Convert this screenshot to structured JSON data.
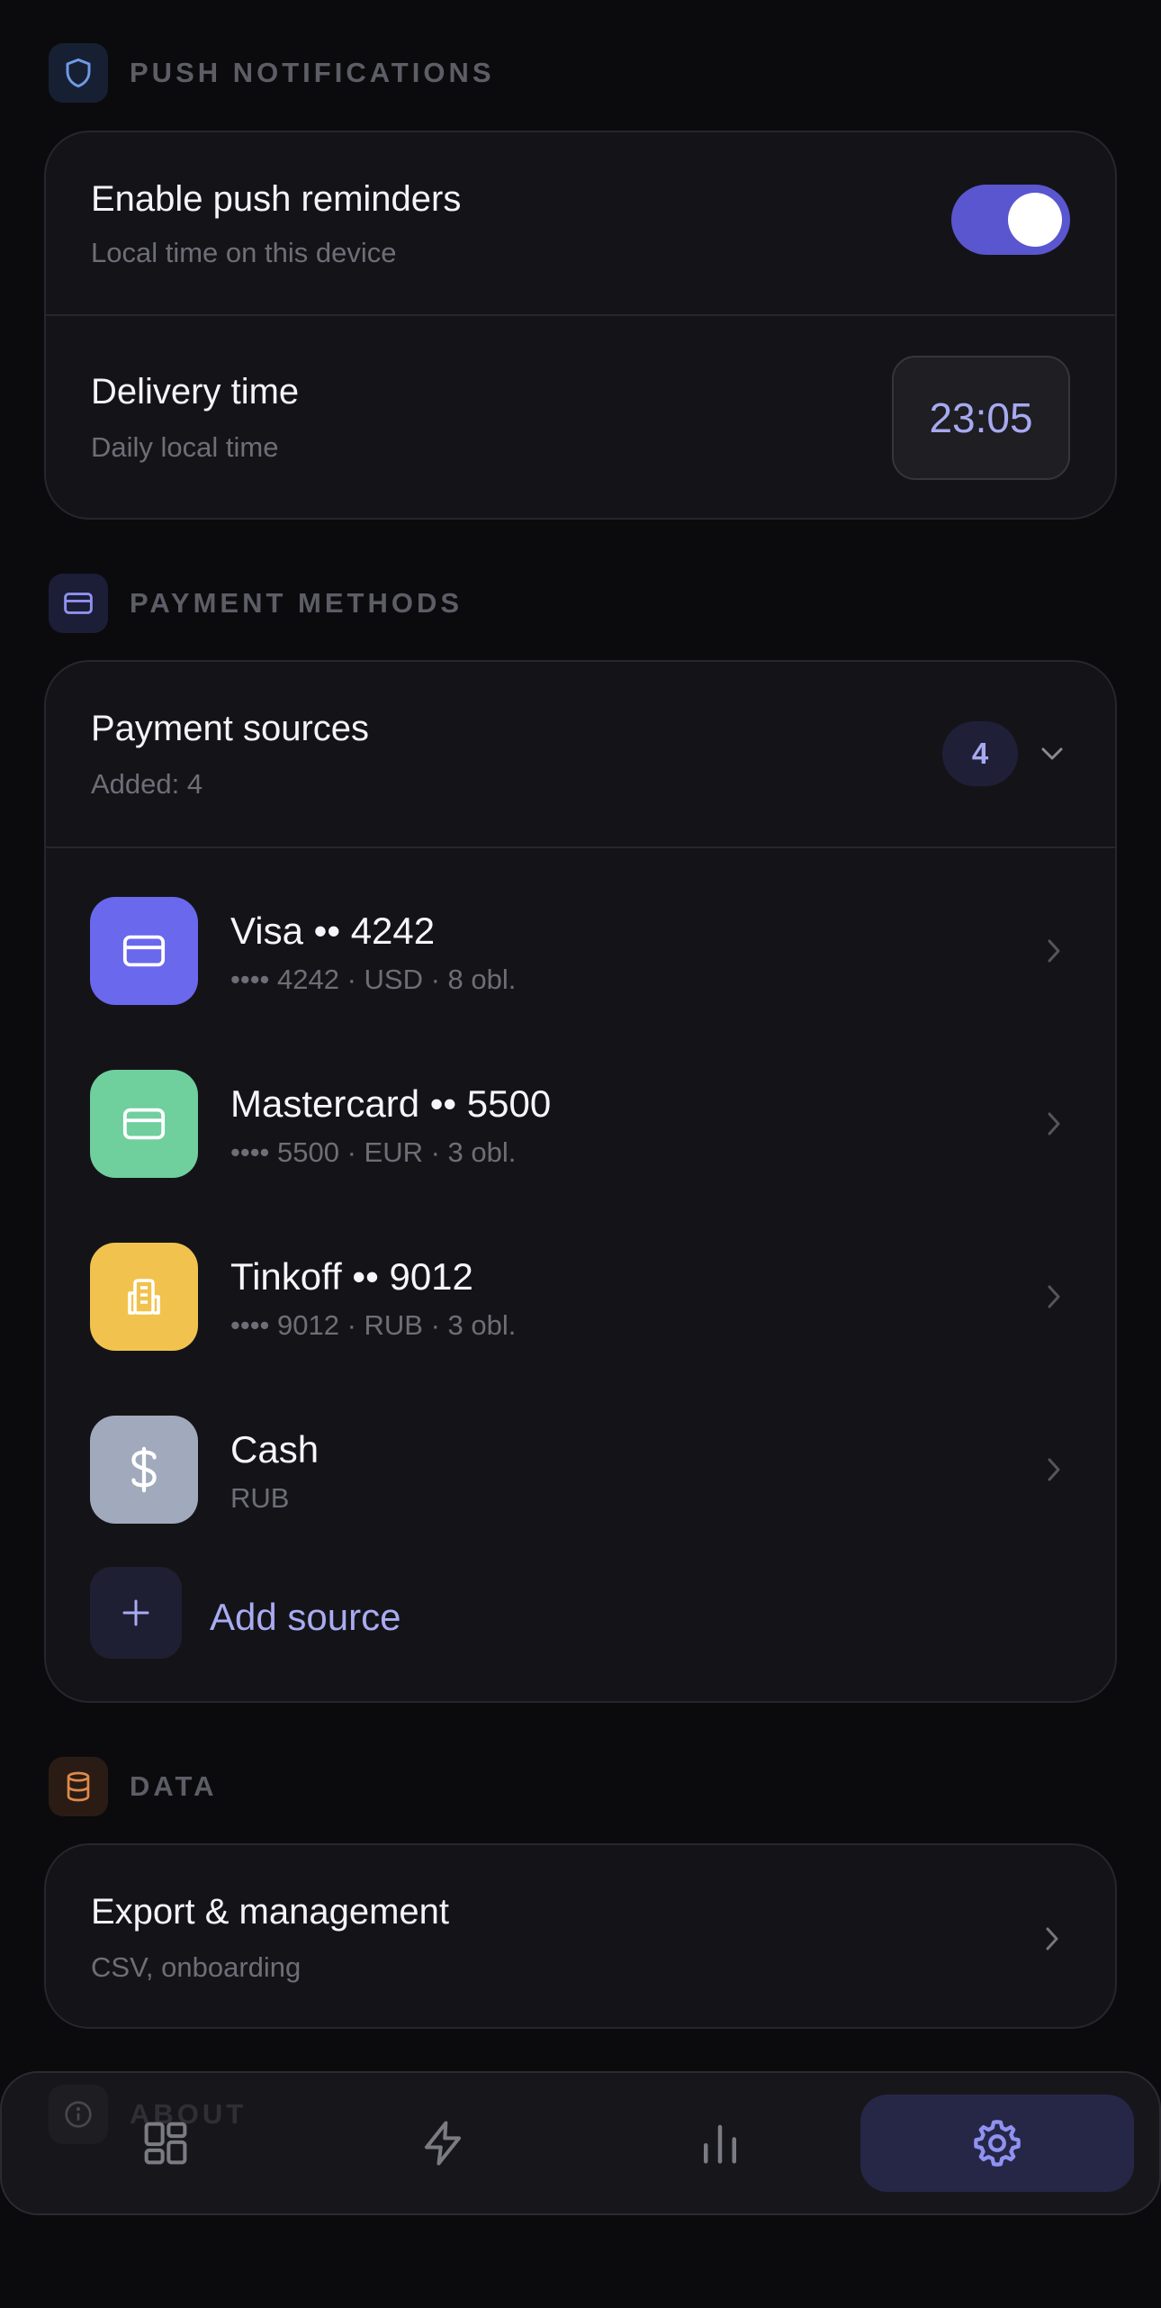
{
  "push": {
    "section_title": "PUSH NOTIFICATIONS",
    "section_icon": "shield-icon",
    "enable_title": "Enable push reminders",
    "enable_sub": "Local time on this device",
    "enabled": true,
    "delivery_title": "Delivery time",
    "delivery_sub": "Daily local time",
    "delivery_time": "23:05"
  },
  "payment": {
    "section_title": "PAYMENT METHODS",
    "section_icon": "credit-card-icon",
    "sources_title": "Payment sources",
    "sources_sub": "Added: 4",
    "count": "4",
    "items": [
      {
        "title": "Visa •• 4242",
        "sub": "•••• 4242 · USD · 8 obl.",
        "icon": "credit-card-icon",
        "color": "#6a68ec"
      },
      {
        "title": "Mastercard •• 5500",
        "sub": "•••• 5500 · EUR · 3 obl.",
        "icon": "credit-card-icon",
        "color": "#6fcf9d"
      },
      {
        "title": "Tinkoff •• 9012",
        "sub": "•••• 9012 · RUB · 3 obl.",
        "icon": "bank-building-icon",
        "color": "#f1c24d"
      },
      {
        "title": "Cash",
        "sub": "RUB",
        "icon": "dollar-icon",
        "color": "#a1a9bc"
      }
    ],
    "add_label": "Add source"
  },
  "data_section": {
    "section_title": "DATA",
    "section_icon": "database-icon",
    "export_title": "Export & management",
    "export_sub": "CSV, onboarding"
  },
  "about": {
    "section_title": "ABOUT",
    "section_icon": "info-icon"
  },
  "nav": {
    "items": [
      "dashboard-icon",
      "bolt-icon",
      "stats-icon",
      "settings-icon"
    ],
    "active": "settings-icon"
  },
  "colors": {
    "accent": "#5a56cf",
    "accent_text": "#a7a9f0",
    "card_bg": "#141418",
    "page_bg": "#0b0b0e"
  }
}
